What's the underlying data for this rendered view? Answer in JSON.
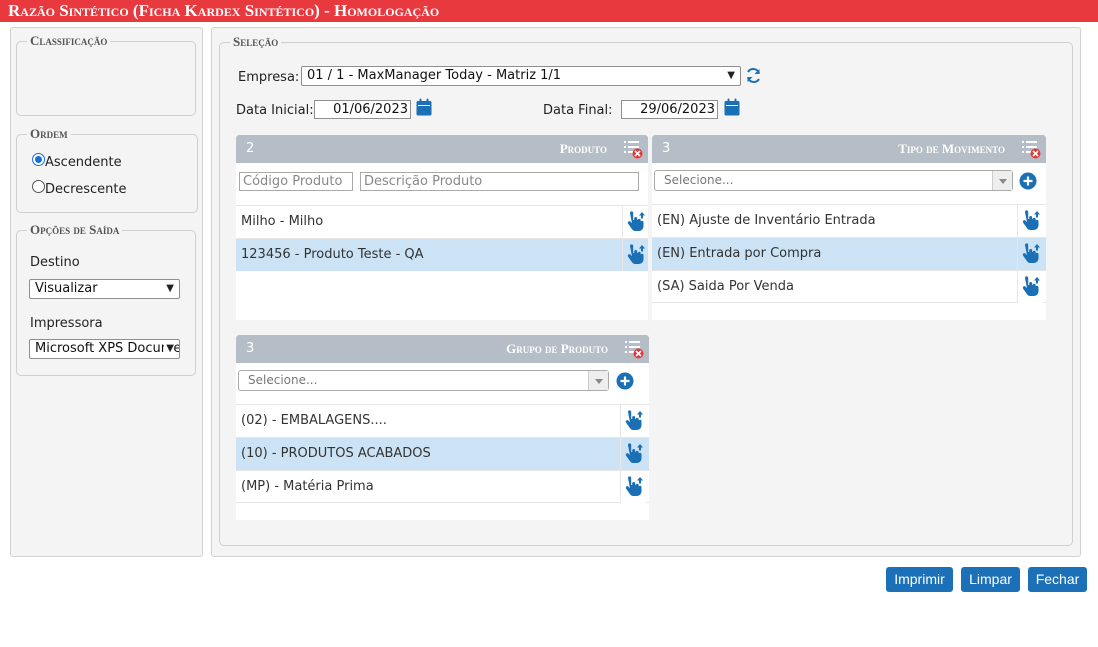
{
  "window": {
    "title": "Razão Sintético (Ficha Kardex Sintético)  - Homologação"
  },
  "sidebar": {
    "classificacao_legend": "Classificação",
    "ordem_legend": "Ordem",
    "ordem_options": [
      {
        "label": "Ascendente",
        "checked": true
      },
      {
        "label": "Decrescente",
        "checked": false
      }
    ],
    "opcoes_legend": "Opções de Saída",
    "destino_label": "Destino",
    "destino_value": "Visualizar",
    "impressora_label": "Impressora",
    "impressora_value": "Microsoft XPS Document Writer"
  },
  "selecao": {
    "legend": "Seleção",
    "empresa_label": "Empresa:",
    "empresa_value": "01 / 1 - MaxManager Today - Matriz 1/1",
    "data_inicial_label": "Data Inicial:",
    "data_inicial_value": "01/06/2023",
    "data_final_label": "Data Final:",
    "data_final_value": "29/06/2023"
  },
  "produto": {
    "count": "2",
    "title": "Produto",
    "codigo_placeholder": "Código Produto",
    "descricao_placeholder": "Descrição Produto",
    "items": [
      {
        "label": "Milho - Milho",
        "selected": false
      },
      {
        "label": "123456 - Produto Teste - QA",
        "selected": true
      }
    ]
  },
  "tipo_movimento": {
    "count": "3",
    "title": "Tipo de Movimento",
    "select_placeholder": "Selecione...",
    "items": [
      {
        "label": "(EN) Ajuste de Inventário Entrada",
        "selected": false
      },
      {
        "label": "(EN) Entrada por Compra",
        "selected": true
      },
      {
        "label": "(SA) Saida Por Venda",
        "selected": false
      }
    ]
  },
  "grupo_produto": {
    "count": "3",
    "title": "Grupo de Produto",
    "select_placeholder": "Selecione...",
    "items": [
      {
        "label": "(02) - EMBALAGENS....",
        "selected": false
      },
      {
        "label": "(10) - PRODUTOS ACABADOS",
        "selected": true
      },
      {
        "label": "(MP) - Matéria Prima",
        "selected": false
      }
    ]
  },
  "footer": {
    "imprimir_label": "Imprimir",
    "limpar_label": "Limpar",
    "fechar_label": "Fechar"
  },
  "colors": {
    "title_bar": "#e8393f",
    "box_header": "#b5bdc6",
    "selected_row": "#cce3f5",
    "button": "#1c70b8",
    "icon_blue": "#1a6fb5",
    "clear_icon_red": "#e03a3a"
  },
  "icons": [
    "refresh-icon",
    "calendar-icon",
    "clear-list-icon",
    "add-icon",
    "hand-pointer-icon"
  ]
}
